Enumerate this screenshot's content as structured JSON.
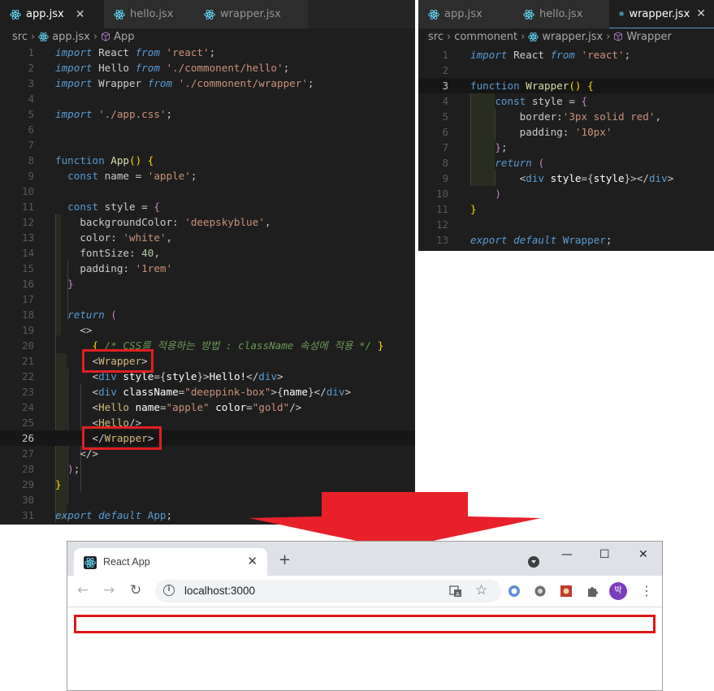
{
  "left_editor": {
    "tabs": [
      {
        "label": "app.jsx",
        "active": true,
        "close": "✕"
      },
      {
        "label": "hello.jsx",
        "active": false
      },
      {
        "label": "wrapper.jsx",
        "active": false
      }
    ],
    "breadcrumb": [
      "src",
      "app.jsx",
      "App"
    ]
  },
  "right_editor": {
    "tabs": [
      {
        "label": "app.jsx",
        "active": false
      },
      {
        "label": "hello.jsx",
        "active": false
      },
      {
        "label": "wrapper.jsx",
        "active": true,
        "close": "✕"
      }
    ],
    "breadcrumb": [
      "src",
      "commonent",
      "wrapper.jsx",
      "Wrapper"
    ]
  },
  "app_code_lines": [
    [
      [
        "k",
        "import"
      ],
      [
        "p",
        " React "
      ],
      [
        "k",
        "from"
      ],
      [
        "s",
        " 'react'"
      ],
      [
        "p",
        ";"
      ]
    ],
    [
      [
        "k",
        "import"
      ],
      [
        "p",
        " Hello "
      ],
      [
        "k",
        "from"
      ],
      [
        "s",
        " './commonent/hello'"
      ],
      [
        "p",
        ";"
      ]
    ],
    [
      [
        "k",
        "import"
      ],
      [
        "p",
        " Wrapper "
      ],
      [
        "k",
        "from"
      ],
      [
        "s",
        " './commonent/wrapper'"
      ],
      [
        "p",
        ";"
      ]
    ],
    [],
    [
      [
        "k",
        "import"
      ],
      [
        "s",
        " './app.css'"
      ],
      [
        "p",
        ";"
      ]
    ],
    [],
    [],
    [
      [
        "kf",
        "function"
      ],
      [
        "f",
        " App"
      ],
      [
        "y",
        "()"
      ],
      [
        "p",
        " "
      ],
      [
        "y",
        "{"
      ]
    ],
    [
      [
        "p",
        "  "
      ],
      [
        "kf",
        "const"
      ],
      [
        "p",
        " name = "
      ],
      [
        "s",
        "'apple'"
      ],
      [
        "p",
        ";"
      ]
    ],
    [],
    [
      [
        "p",
        "  "
      ],
      [
        "kf",
        "const"
      ],
      [
        "p",
        " style = "
      ],
      [
        "r",
        "{"
      ]
    ],
    [
      [
        "p",
        "    backgroundColor: "
      ],
      [
        "s",
        "'deepskyblue'"
      ],
      [
        "p",
        ","
      ]
    ],
    [
      [
        "p",
        "    color: "
      ],
      [
        "s",
        "'white'"
      ],
      [
        "p",
        ","
      ]
    ],
    [
      [
        "p",
        "    fontSize: "
      ],
      [
        "n",
        "40"
      ],
      [
        "p",
        ","
      ]
    ],
    [
      [
        "p",
        "    padding: "
      ],
      [
        "s",
        "'1rem'"
      ]
    ],
    [
      [
        "p",
        "  "
      ],
      [
        "r",
        "}"
      ]
    ],
    [],
    [
      [
        "p",
        "  "
      ],
      [
        "k",
        "return"
      ],
      [
        "p",
        " "
      ],
      [
        "r",
        "("
      ]
    ],
    [
      [
        "p",
        "    "
      ],
      [
        "p",
        "<>"
      ]
    ],
    [
      [
        "p",
        "      "
      ],
      [
        "y",
        "{"
      ],
      [
        "c",
        " /* CSS를 적용하는 방법 : className 속성에 적용 */ "
      ],
      [
        "y",
        "}"
      ]
    ],
    [
      [
        "p",
        "      "
      ],
      [
        "p",
        "<"
      ],
      [
        "t",
        "Wrapper"
      ],
      [
        "p",
        ">"
      ]
    ],
    [
      [
        "p",
        "      "
      ],
      [
        "p",
        "<"
      ],
      [
        "fn",
        "div"
      ],
      [
        "w",
        " style"
      ],
      [
        "p",
        "={"
      ],
      [
        "w",
        "style"
      ],
      [
        "p",
        "}>"
      ],
      [
        "w",
        "Hello!"
      ],
      [
        "p",
        "</"
      ],
      [
        "fn",
        "div"
      ],
      [
        "p",
        ">"
      ]
    ],
    [
      [
        "p",
        "      "
      ],
      [
        "p",
        "<"
      ],
      [
        "fn",
        "div"
      ],
      [
        "w",
        " className"
      ],
      [
        "p",
        "="
      ],
      [
        "s",
        "\"deeppink-box\""
      ],
      [
        "p",
        ">{"
      ],
      [
        "w",
        "name"
      ],
      [
        "p",
        "}</"
      ],
      [
        "fn",
        "div"
      ],
      [
        "p",
        ">"
      ]
    ],
    [
      [
        "p",
        "      "
      ],
      [
        "p",
        "<"
      ],
      [
        "t",
        "Hello"
      ],
      [
        "w",
        " name"
      ],
      [
        "p",
        "="
      ],
      [
        "s",
        "\"apple\""
      ],
      [
        "w",
        " color"
      ],
      [
        "p",
        "="
      ],
      [
        "s",
        "\"gold\""
      ],
      [
        "p",
        "/>"
      ]
    ],
    [
      [
        "p",
        "      "
      ],
      [
        "p",
        "<"
      ],
      [
        "t",
        "Hello"
      ],
      [
        "p",
        "/>"
      ]
    ],
    [
      [
        "p",
        "      "
      ],
      [
        "p",
        "</"
      ],
      [
        "t",
        "Wrapper"
      ],
      [
        "p",
        ">"
      ]
    ],
    [
      [
        "p",
        "    "
      ],
      [
        "p",
        "</>"
      ]
    ],
    [
      [
        "p",
        "  "
      ],
      [
        "r",
        ")"
      ],
      [
        "p",
        ";"
      ]
    ],
    [
      [
        "y",
        "}"
      ]
    ],
    [],
    [
      [
        "k",
        "export"
      ],
      [
        "p",
        " "
      ],
      [
        "k",
        "default"
      ],
      [
        "fn",
        " App"
      ],
      [
        "p",
        ";"
      ]
    ]
  ],
  "wrapper_code_lines": [
    [
      [
        "k",
        "import"
      ],
      [
        "p",
        " React "
      ],
      [
        "k",
        "from"
      ],
      [
        "s",
        " 'react'"
      ],
      [
        "p",
        ";"
      ]
    ],
    [],
    [
      [
        "kf",
        "function"
      ],
      [
        "f",
        " Wrapper"
      ],
      [
        "y",
        "()"
      ],
      [
        "p",
        " "
      ],
      [
        "y",
        "{"
      ]
    ],
    [
      [
        "p",
        "    "
      ],
      [
        "kf",
        "const"
      ],
      [
        "p",
        " style = "
      ],
      [
        "r",
        "{"
      ]
    ],
    [
      [
        "p",
        "        border:"
      ],
      [
        "s",
        "'3px solid red'"
      ],
      [
        "p",
        ","
      ]
    ],
    [
      [
        "p",
        "        padding: "
      ],
      [
        "s",
        "'10px'"
      ]
    ],
    [
      [
        "p",
        "    "
      ],
      [
        "r",
        "}"
      ],
      [
        "p",
        ";"
      ]
    ],
    [
      [
        "p",
        "    "
      ],
      [
        "k",
        "return"
      ],
      [
        "p",
        " "
      ],
      [
        "r",
        "("
      ]
    ],
    [
      [
        "p",
        "        <"
      ],
      [
        "fn",
        "div"
      ],
      [
        "w",
        " style"
      ],
      [
        "p",
        "={"
      ],
      [
        "w",
        "style"
      ],
      [
        "p",
        "}></"
      ],
      [
        "fn",
        "div"
      ],
      [
        "p",
        ">"
      ]
    ],
    [
      [
        "p",
        "    "
      ],
      [
        "r",
        ")"
      ]
    ],
    [
      [
        "y",
        "}"
      ]
    ],
    [],
    [
      [
        "k",
        "export"
      ],
      [
        "p",
        " "
      ],
      [
        "k",
        "default"
      ],
      [
        "fn",
        " Wrapper"
      ],
      [
        "p",
        ";"
      ]
    ]
  ],
  "browser": {
    "tab_title": "React App",
    "tab_close": "✕",
    "new_tab": "+",
    "minimize": "—",
    "maximize": "☐",
    "close": "✕",
    "back": "←",
    "forward": "→",
    "reload": "↻",
    "url": "localhost:3000",
    "avatar": "박",
    "menu": "⋮",
    "star": "☆",
    "info": "i"
  },
  "colors": {
    "highlight_red": "#e02020",
    "arrow_red": "#e8202a",
    "editor_bg": "#1e1e1e"
  }
}
